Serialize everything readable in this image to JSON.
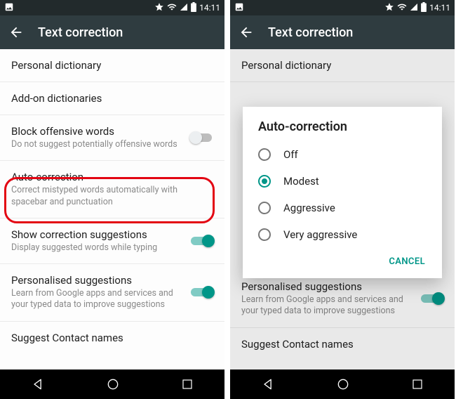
{
  "status": {
    "time": "14:11"
  },
  "appbar": {
    "title": "Text correction"
  },
  "settings": {
    "personal_dictionary": {
      "title": "Personal dictionary"
    },
    "addon_dictionaries": {
      "title": "Add-on dictionaries"
    },
    "block_offensive": {
      "title": "Block offensive words",
      "sub": "Do not suggest potentially offensive words"
    },
    "auto_correction": {
      "title": "Auto-correction",
      "sub": "Correct mistyped words automatically with spacebar and punctuation"
    },
    "show_suggestions": {
      "title": "Show correction suggestions",
      "sub": "Display suggested words while typing"
    },
    "personalised": {
      "title": "Personalised suggestions",
      "sub": "Learn from Google apps and services and your typed data to improve suggestions"
    },
    "suggest_contacts": {
      "title": "Suggest Contact names"
    }
  },
  "dialog": {
    "title": "Auto-correction",
    "options": {
      "off": "Off",
      "modest": "Modest",
      "aggressive": "Aggressive",
      "very_aggressive": "Very aggressive"
    },
    "selected": "modest",
    "cancel": "CANCEL"
  },
  "colors": {
    "accent": "#009688",
    "highlight": "#e30613"
  }
}
